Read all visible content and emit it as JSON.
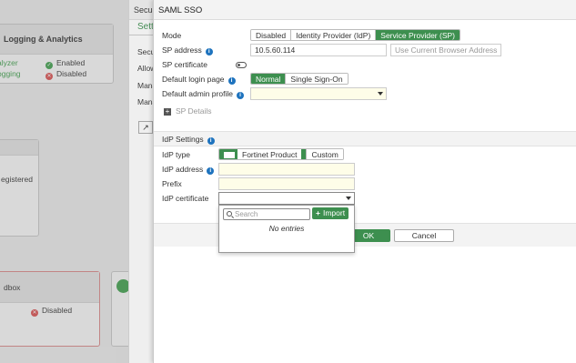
{
  "background": {
    "tab_fragment": "Securi",
    "tab_fragment2": "Setti",
    "logging_header": "Logging & Analytics",
    "analyzer_label": "alyzer",
    "analyzer_status": "Enabled",
    "logging_label": "ogging",
    "logging_status": "Disabled",
    "registered_label": "egistered",
    "sandbox_label": "dbox",
    "sandbox_status": "Disabled",
    "secu_label": "Secu",
    "allow_label": "Allow",
    "mana_label1": "Mana",
    "mana_label2": "Mana"
  },
  "modal": {
    "title": "SAML SSO",
    "mode_label": "Mode",
    "mode_options": [
      "Disabled",
      "Identity Provider (IdP)",
      "Service Provider (SP)"
    ],
    "sp_address_label": "SP address",
    "sp_address_value": "10.5.60.114",
    "use_current_label": "Use Current Browser Address",
    "sp_cert_label": "SP certificate",
    "login_page_label": "Default login page",
    "login_page_options": [
      "Normal",
      "Single Sign-On"
    ],
    "admin_profile_label": "Default admin profile",
    "admin_profile_value": "",
    "sp_details_label": "SP Details",
    "idp_settings_label": "IdP Settings",
    "idp_type_label": "IdP type",
    "idp_type_options": [
      "Fortinet Product",
      "Custom"
    ],
    "idp_address_label": "IdP address",
    "idp_address_value": "",
    "prefix_label": "Prefix",
    "prefix_value": "",
    "idp_cert_label": "IdP certificate",
    "idp_cert_value": "",
    "ok_label": "OK",
    "cancel_label": "Cancel"
  },
  "dropdown": {
    "search_placeholder": "Search",
    "import_label": "Import",
    "empty_text": "No entries"
  },
  "colors": {
    "active_green": "#3d8f4f",
    "info_blue": "#1e73be",
    "enabled_green": "#3fa34d",
    "disabled_red": "#e05050"
  }
}
